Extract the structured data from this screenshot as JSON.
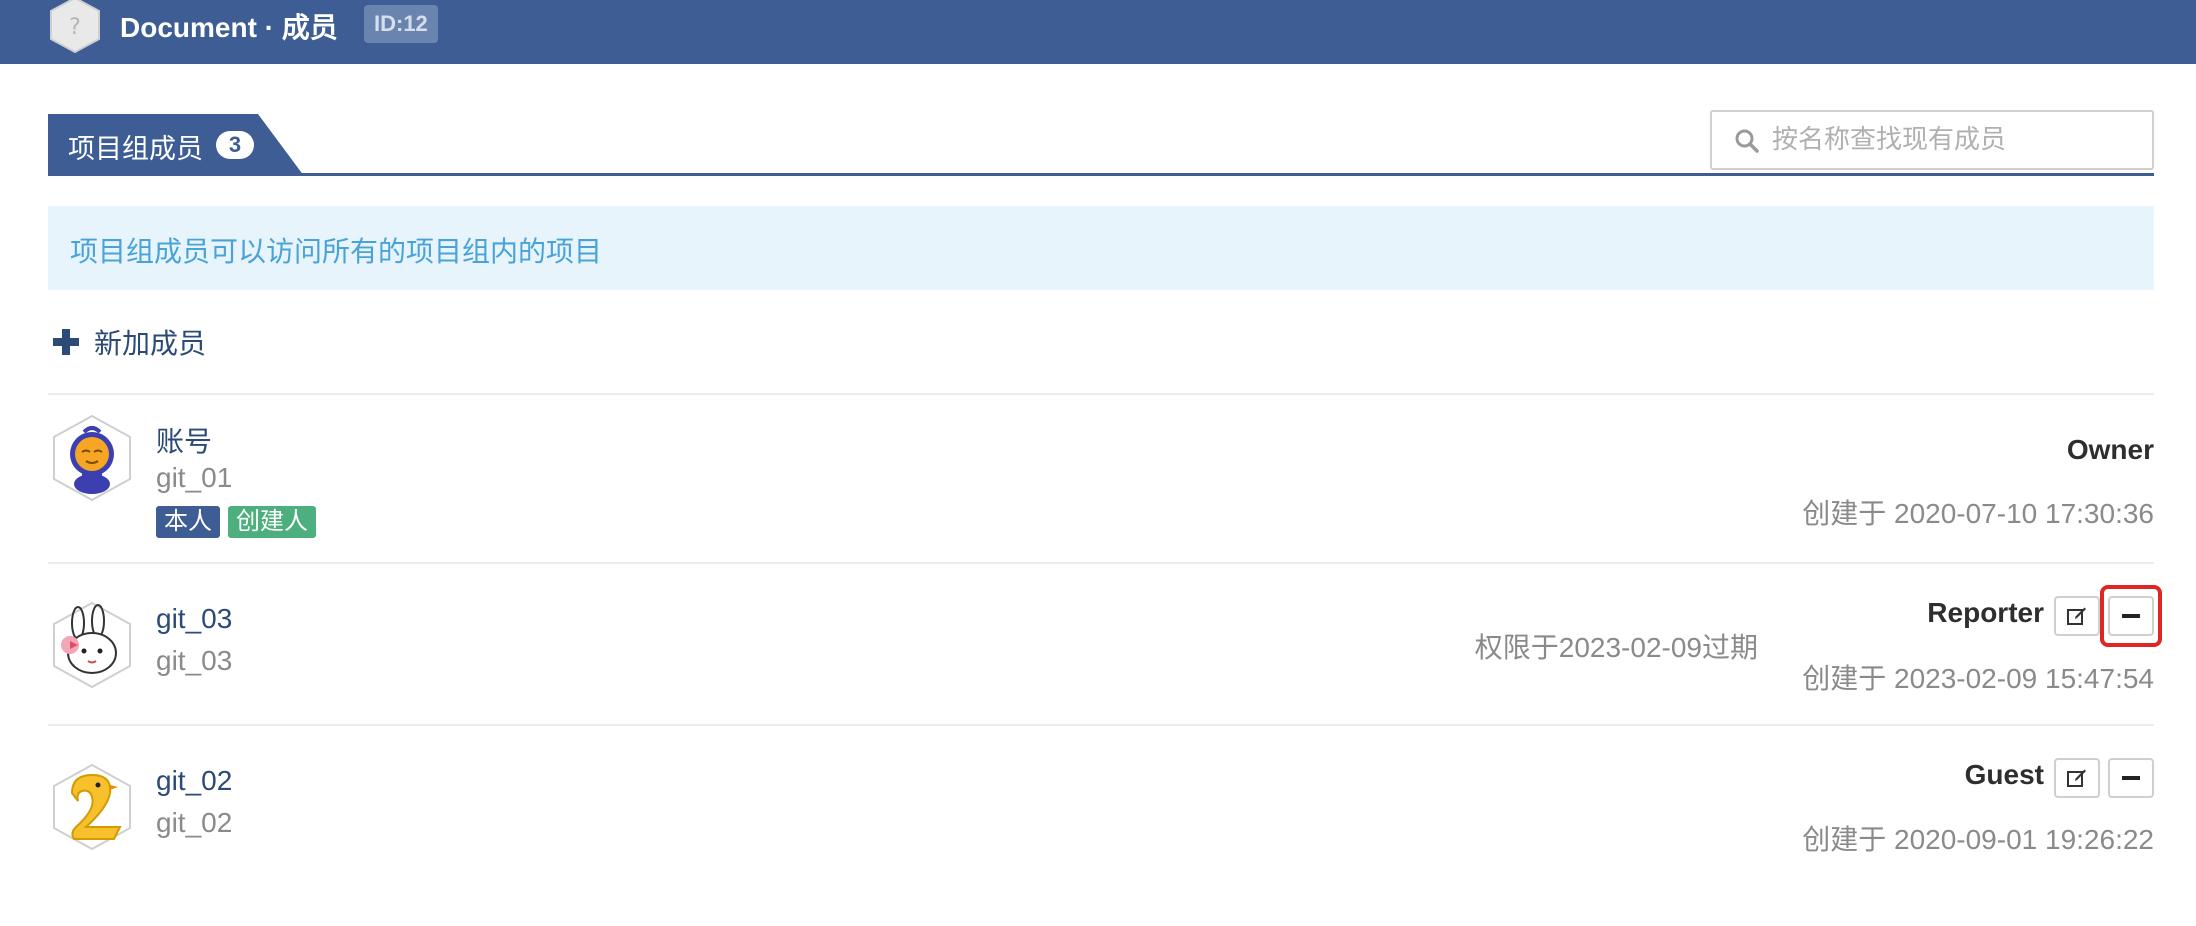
{
  "header": {
    "title": "Document · 成员",
    "id_badge": "ID:12"
  },
  "tab": {
    "label": "项目组成员",
    "count": "3"
  },
  "search": {
    "placeholder": "按名称查找现有成员",
    "value": ""
  },
  "info_banner": "项目组成员可以访问所有的项目组内的项目",
  "add_member_label": "新加成员",
  "members": [
    {
      "name": "账号",
      "username": "git_01",
      "tags": [
        "本人",
        "创建人"
      ],
      "role": "Owner",
      "created": "创建于 2020-07-10 17:30:36",
      "expires": "",
      "avatar": "blue-orange-creature-avatar"
    },
    {
      "name": "git_03",
      "username": "git_03",
      "tags": [],
      "role": "Reporter",
      "created": "创建于 2023-02-09 15:47:54",
      "expires": "权限于2023-02-09过期",
      "avatar": "bunny-sketch-avatar"
    },
    {
      "name": "git_02",
      "username": "git_02",
      "tags": [],
      "role": "Guest",
      "created": "创建于 2020-09-01 19:26:22",
      "expires": "",
      "avatar": "yellow-duck-avatar"
    }
  ],
  "icons": {
    "edit": "edit-icon",
    "remove": "minus-icon",
    "add": "plus-icon",
    "search": "search-icon"
  },
  "colors": {
    "header_bg": "#3d5d94",
    "link": "#2b4a78",
    "info_bg": "#e8f4fc",
    "info_text": "#4aa3d8",
    "tag_self": "#3d5d94",
    "tag_creator": "#4caf7d",
    "highlight": "#e02525"
  }
}
